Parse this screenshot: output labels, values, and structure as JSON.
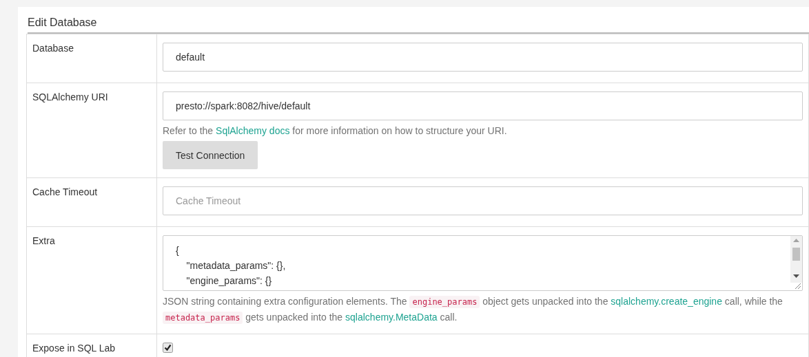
{
  "page": {
    "title": "Edit Database"
  },
  "rows": [
    {
      "label": "Database",
      "kind": "input",
      "value": "default"
    },
    {
      "label": "SQLAlchemy URI",
      "kind": "input",
      "value": "presto://spark:8082/hive/default",
      "help": [
        {
          "kind": "text",
          "text": "Refer to the "
        },
        {
          "kind": "link",
          "text": "SqlAlchemy docs"
        },
        {
          "kind": "text",
          "text": " for more information on how to structure your URI."
        }
      ],
      "button": "Test Connection"
    },
    {
      "label": "Cache Timeout",
      "kind": "input",
      "placeholder": "Cache Timeout"
    },
    {
      "label": "Extra",
      "kind": "textarea",
      "value": "{\n    \"metadata_params\": {},\n    \"engine_params\": {}",
      "help": [
        {
          "kind": "text",
          "text": "JSON string containing extra configuration elements. The "
        },
        {
          "kind": "code",
          "text": "engine_params"
        },
        {
          "kind": "text",
          "text": " object gets unpacked into the "
        },
        {
          "kind": "link",
          "text": "sqlalchemy.create_engine"
        },
        {
          "kind": "text",
          "text": " call, while the "
        },
        {
          "kind": "code",
          "text": "metadata_params"
        },
        {
          "kind": "text",
          "text": " gets unpacked into the "
        },
        {
          "kind": "link",
          "text": "sqlalchemy.MetaData"
        },
        {
          "kind": "text",
          "text": " call."
        }
      ]
    },
    {
      "label": "Expose in SQL Lab",
      "kind": "checkbox",
      "checked": true
    }
  ]
}
